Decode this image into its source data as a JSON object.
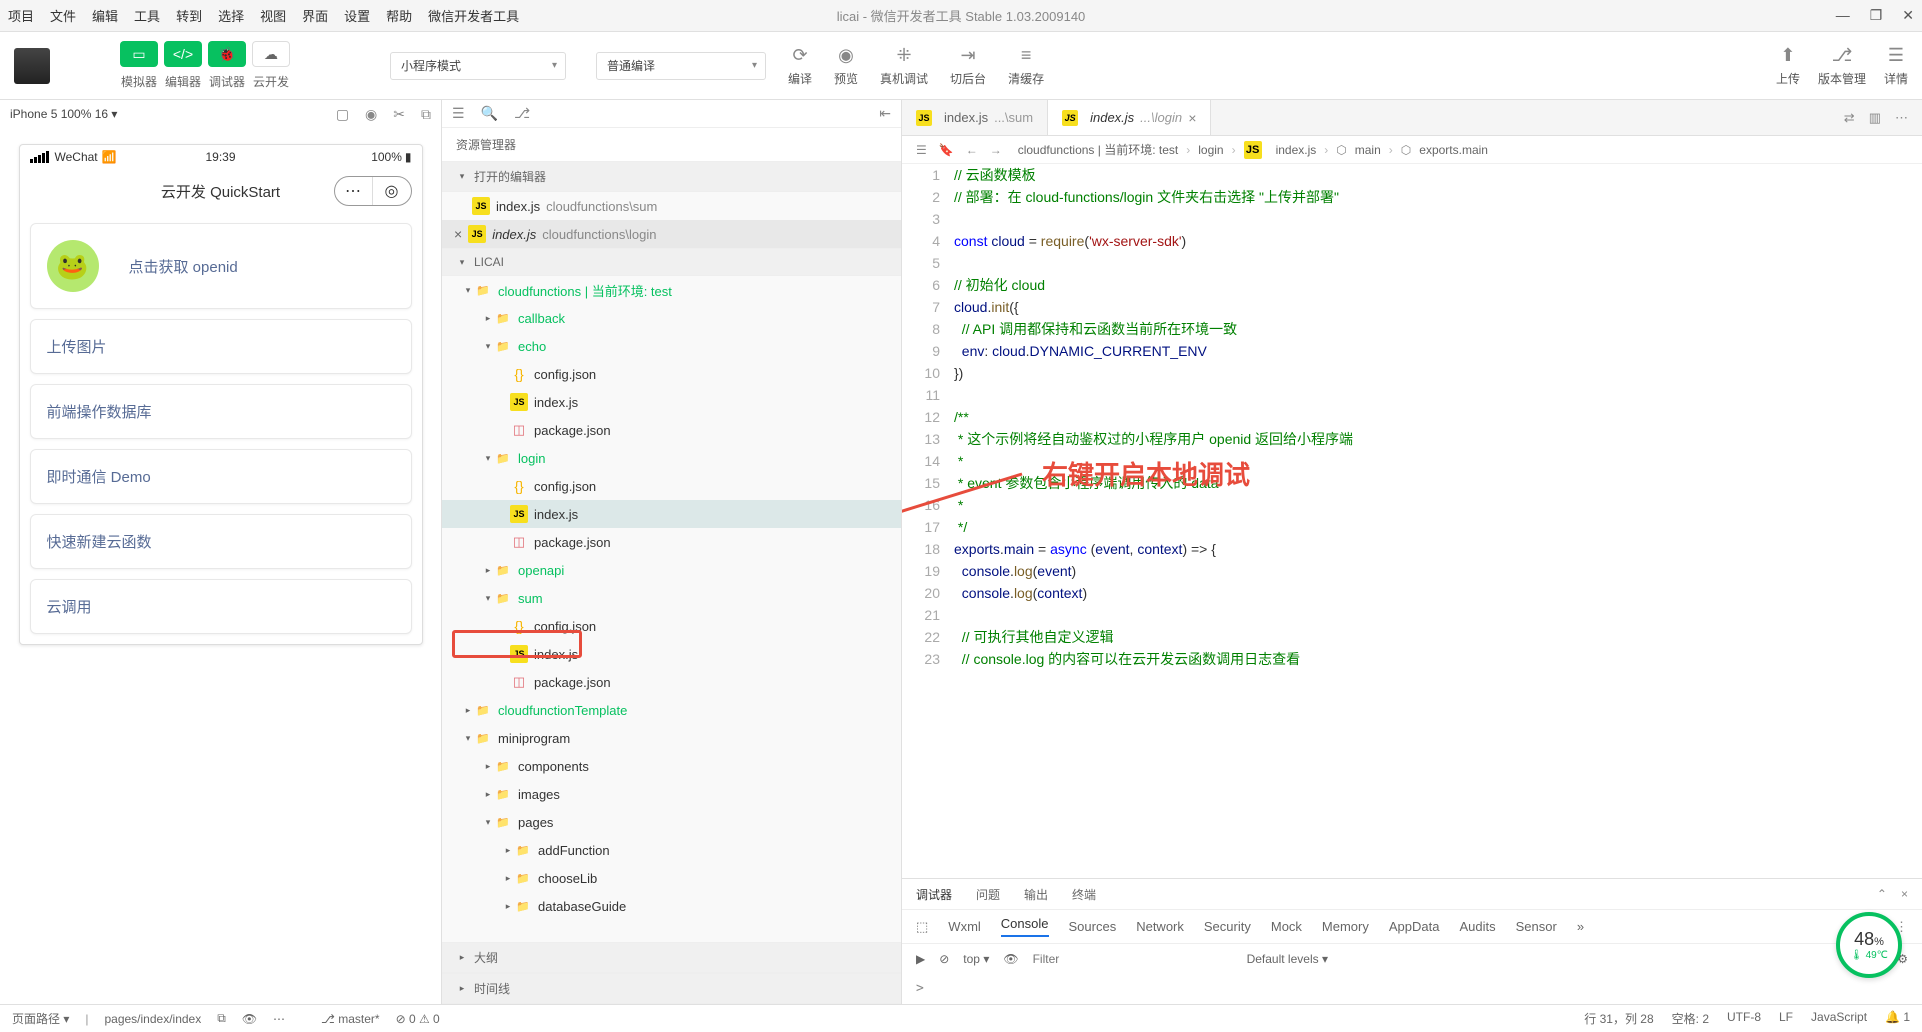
{
  "window": {
    "title": "licai - 微信开发者工具 Stable 1.03.2009140",
    "menu": [
      "项目",
      "文件",
      "编辑",
      "工具",
      "转到",
      "选择",
      "视图",
      "界面",
      "设置",
      "帮助",
      "微信开发者工具"
    ]
  },
  "toolbar": {
    "buttons": [
      {
        "label": "模拟器"
      },
      {
        "label": "编辑器"
      },
      {
        "label": "调试器"
      },
      {
        "label": "云开发"
      }
    ],
    "mode_select": "小程序模式",
    "compile_select": "普通编译",
    "actions": [
      {
        "label": "编译"
      },
      {
        "label": "预览"
      },
      {
        "label": "真机调试"
      },
      {
        "label": "切后台"
      },
      {
        "label": "清缓存"
      }
    ],
    "right": [
      {
        "label": "上传"
      },
      {
        "label": "版本管理"
      },
      {
        "label": "详情"
      }
    ]
  },
  "simulator": {
    "device": "iPhone 5 100% 16",
    "status": {
      "carrier": "WeChat",
      "time": "19:39",
      "battery": "100%"
    },
    "nav_title": "云开发 QuickStart",
    "openid_link": "点击获取 openid",
    "cards": [
      "上传图片",
      "前端操作数据库",
      "即时通信 Demo",
      "快速新建云函数",
      "云调用"
    ]
  },
  "explorer": {
    "title": "资源管理器",
    "open_editors": "打开的编辑器",
    "open_files": [
      {
        "name": "index.js",
        "path": "cloudfunctions\\sum"
      },
      {
        "name": "index.js",
        "path": "cloudfunctions\\login",
        "italic": true,
        "closable": true
      }
    ],
    "project": "LICAI",
    "tree": {
      "cloudfunctions_label": "cloudfunctions | 当前环境: test",
      "folders": {
        "callback": "callback",
        "echo": "echo",
        "login": "login",
        "openapi": "openapi",
        "sum": "sum",
        "cloudfunctionTemplate": "cloudfunctionTemplate",
        "miniprogram": "miniprogram",
        "components": "components",
        "images": "images",
        "pages": "pages",
        "addFunction": "addFunction",
        "chooseLib": "chooseLib",
        "databaseGuide": "databaseGuide"
      },
      "files": {
        "config_json": "config.json",
        "index_js": "index.js",
        "package_json": "package.json"
      }
    },
    "sections": {
      "outline": "大纲",
      "timeline": "时间线"
    }
  },
  "editor": {
    "tabs": [
      {
        "name": "index.js",
        "suffix": "...\\sum"
      },
      {
        "name": "index.js",
        "suffix": "...\\login",
        "active": true
      }
    ],
    "breadcrumb": [
      "cloudfunctions | 当前环境: test",
      "login",
      "index.js",
      "main",
      "exports.main"
    ],
    "code_lines": [
      {
        "n": 1,
        "t": "// 云函数模板",
        "cls": "c-comment"
      },
      {
        "n": 2,
        "html": "<span class='c-comment'>// 部署：在 cloud-functions/login 文件夹右击选择 \"上传并部署\"</span>"
      },
      {
        "n": 3,
        "t": ""
      },
      {
        "n": 4,
        "html": "<span class='c-kw'>const</span> <span class='c-var'>cloud</span> = <span class='c-fn'>require</span>(<span class='c-str'>'wx-server-sdk'</span>)"
      },
      {
        "n": 5,
        "t": ""
      },
      {
        "n": 6,
        "t": "// 初始化 cloud",
        "cls": "c-comment"
      },
      {
        "n": 7,
        "html": "<span class='c-var'>cloud</span>.<span class='c-fn'>init</span>({",
        "fold": true
      },
      {
        "n": 8,
        "html": "  <span class='c-comment'>// API 调用都保持和云函数当前所在环境一致</span>"
      },
      {
        "n": 9,
        "html": "  <span class='c-prop'>env</span>: <span class='c-var'>cloud</span>.<span class='c-var'>DYNAMIC_CURRENT_ENV</span>"
      },
      {
        "n": 10,
        "t": "})"
      },
      {
        "n": 11,
        "t": ""
      },
      {
        "n": 12,
        "t": "/**",
        "cls": "c-comment"
      },
      {
        "n": 13,
        "t": " * 这个示例将经自动鉴权过的小程序用户 openid 返回给小程序端",
        "cls": "c-comment"
      },
      {
        "n": 14,
        "t": " *",
        "cls": "c-comment"
      },
      {
        "n": 15,
        "t": " * event 参数包含小程序端调用传入的 data",
        "cls": "c-comment"
      },
      {
        "n": 16,
        "t": " *",
        "cls": "c-comment"
      },
      {
        "n": 17,
        "t": " */",
        "cls": "c-comment"
      },
      {
        "n": 18,
        "html": "<span class='c-var'>exports</span>.<span class='c-prop'>main</span> = <span class='c-kw'>async</span> (<span class='c-var'>event</span>, <span class='c-var'>context</span>) =&gt; {",
        "fold": true
      },
      {
        "n": 19,
        "html": "  <span class='c-var'>console</span>.<span class='c-fn'>log</span>(<span class='c-var'>event</span>)"
      },
      {
        "n": 20,
        "html": "  <span class='c-var'>console</span>.<span class='c-fn'>log</span>(<span class='c-var'>context</span>)"
      },
      {
        "n": 21,
        "t": ""
      },
      {
        "n": 22,
        "t": "  // 可执行其他自定义逻辑",
        "cls": "c-comment"
      },
      {
        "n": 23,
        "t": "  // console.log 的内容可以在云开发云函数调用日志查看",
        "cls": "c-comment"
      }
    ],
    "annotation": "右键开启本地调试"
  },
  "debugger": {
    "top_tabs": [
      "调试器",
      "问题",
      "输出",
      "终端"
    ],
    "dev_tabs": [
      "Wxml",
      "Console",
      "Sources",
      "Network",
      "Security",
      "Mock",
      "Memory",
      "AppData",
      "Audits",
      "Sensor"
    ],
    "console": {
      "context": "top",
      "filter_placeholder": "Filter",
      "levels": "Default levels ▾",
      "prompt": ">"
    }
  },
  "perf": {
    "value": "48",
    "unit": "%",
    "temp": "49℃"
  },
  "statusbar": {
    "left": [
      "页面路径 ▾",
      "pages/index/index"
    ],
    "branch": "master*",
    "errors": "⊘ 0 ⚠ 0",
    "right": [
      "行 31，列 28",
      "空格: 2",
      "UTF-8",
      "LF",
      "JavaScript",
      "🔔 1"
    ]
  }
}
